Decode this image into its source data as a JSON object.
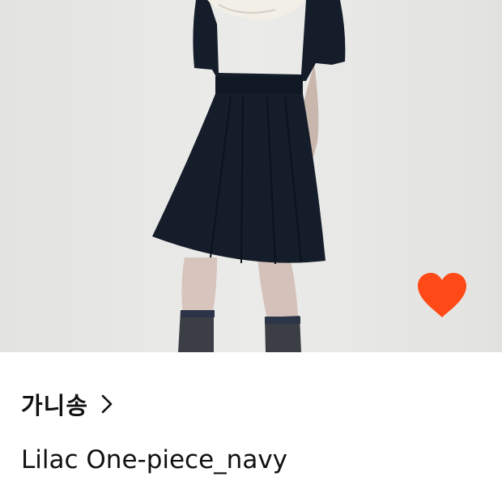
{
  "product": {
    "brand_name": "가니송",
    "name": "Lilac One-piece_navy",
    "liked": true
  },
  "icons": {
    "like": "heart-icon",
    "brand_arrow": "chevron-right-icon"
  },
  "colors": {
    "heart": "#ff4a17",
    "text": "#111111",
    "photo_background": "#e8e8e6",
    "dress": "#141d29"
  }
}
